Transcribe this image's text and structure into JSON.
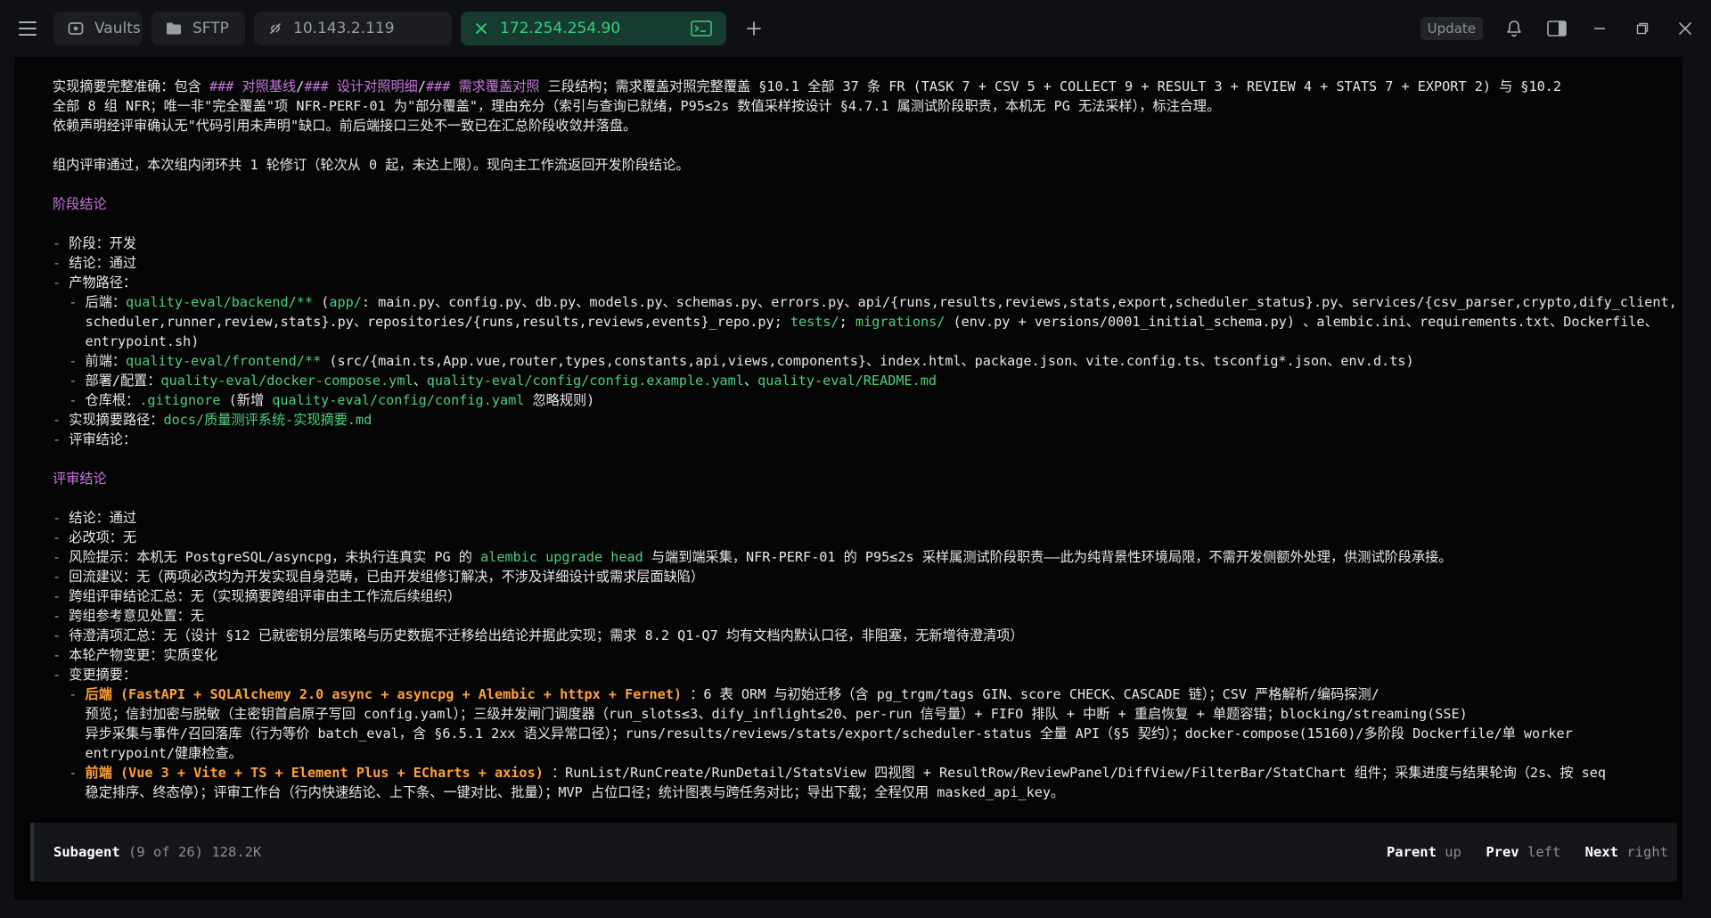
{
  "tabs": {
    "vaults": "Vaults",
    "sftp": "SFTP",
    "host1": "10.143.2.119",
    "host2": "172.254.254.90"
  },
  "topbar": {
    "update": "Update"
  },
  "colors": {
    "accent_green": "#35d07f",
    "path_green": "#4cd07d",
    "heading_purple": "#c678dd",
    "highlight_orange": "#ffa13a"
  },
  "terminal": {
    "lines": [
      [
        [
          "n",
          "实现摘要完整准确：包含 "
        ],
        [
          "p",
          "### 对照基线"
        ],
        [
          "n",
          "/"
        ],
        [
          "p",
          "### 设计对照明细"
        ],
        [
          "n",
          "/"
        ],
        [
          "p",
          "### 需求覆盖对照"
        ],
        [
          "n",
          " 三段结构；需求覆盖对照完整覆盖 §10.1 全部 37 条 FR (TASK 7 + CSV 5 + COLLECT 9 + RESULT 3 + REVIEW 4 + STATS 7 + EXPORT 2) 与 §10.2"
        ]
      ],
      [
        [
          "n",
          "全部 8 组 NFR；唯一非\"完全覆盖\"项 NFR-PERF-01 为\"部分覆盖\"，理由充分（索引与查询已就绪，P95≤2s 数值采样按设计 §4.7.1 属测试阶段职责，本机无 PG 无法采样），标注合理。"
        ]
      ],
      [
        [
          "n",
          "依赖声明经评审确认无\"代码引用未声明\"缺口。前后端接口三处不一致已在汇总阶段收敛并落盘。"
        ]
      ],
      [],
      [
        [
          "n",
          "组内评审通过，本次组内闭环共 1 轮修订（轮次从 0 起，未达上限）。现向主工作流返回开发阶段结论。"
        ]
      ],
      [],
      [
        [
          "p",
          "阶段结论"
        ]
      ],
      [],
      [
        [
          "p",
          "- "
        ],
        [
          "n",
          "阶段：开发"
        ]
      ],
      [
        [
          "p",
          "- "
        ],
        [
          "n",
          "结论：通过"
        ]
      ],
      [
        [
          "p",
          "- "
        ],
        [
          "n",
          "产物路径："
        ]
      ],
      [
        [
          "p",
          "  - "
        ],
        [
          "n",
          "后端："
        ],
        [
          "g",
          "quality-eval/backend/**"
        ],
        [
          "n",
          " ("
        ],
        [
          "g",
          "app/"
        ],
        [
          "n",
          ": main.py、config.py、db.py、models.py、schemas.py、errors.py、api/{runs,results,reviews,stats,export,scheduler_status}.py、services/{csv_parser,crypto,dify_client,"
        ]
      ],
      [
        [
          "n",
          "    scheduler,runner,review,stats}.py、repositories/{runs,results,reviews,events}_repo.py; "
        ],
        [
          "g",
          "tests/"
        ],
        [
          "n",
          "; "
        ],
        [
          "g",
          "migrations/"
        ],
        [
          "n",
          " (env.py + versions/0001_initial_schema.py) 、alembic.ini、requirements.txt、Dockerfile、"
        ]
      ],
      [
        [
          "n",
          "    entrypoint.sh)"
        ]
      ],
      [
        [
          "p",
          "  - "
        ],
        [
          "n",
          "前端："
        ],
        [
          "g",
          "quality-eval/frontend/**"
        ],
        [
          "n",
          " (src/{main.ts,App.vue,router,types,constants,api,views,components}、index.html、package.json、vite.config.ts、tsconfig*.json、env.d.ts)"
        ]
      ],
      [
        [
          "p",
          "  - "
        ],
        [
          "n",
          "部署/配置："
        ],
        [
          "g",
          "quality-eval/docker-compose.yml"
        ],
        [
          "n",
          "、"
        ],
        [
          "g",
          "quality-eval/config/config.example.yaml"
        ],
        [
          "n",
          "、"
        ],
        [
          "g",
          "quality-eval/README.md"
        ]
      ],
      [
        [
          "p",
          "  - "
        ],
        [
          "n",
          "仓库根："
        ],
        [
          "g",
          ".gitignore"
        ],
        [
          "n",
          " (新增 "
        ],
        [
          "g",
          "quality-eval/config/config.yaml"
        ],
        [
          "n",
          " 忽略规则)"
        ]
      ],
      [
        [
          "p",
          "- "
        ],
        [
          "n",
          "实现摘要路径："
        ],
        [
          "g",
          "docs/质量测评系统-实现摘要.md"
        ]
      ],
      [
        [
          "p",
          "- "
        ],
        [
          "n",
          "评审结论："
        ]
      ],
      [],
      [
        [
          "p",
          "评审结论"
        ]
      ],
      [],
      [
        [
          "p",
          "- "
        ],
        [
          "n",
          "结论：通过"
        ]
      ],
      [
        [
          "p",
          "- "
        ],
        [
          "n",
          "必改项：无"
        ]
      ],
      [
        [
          "p",
          "- "
        ],
        [
          "n",
          "风险提示：本机无 PostgreSQL/asyncpg，未执行连真实 PG 的 "
        ],
        [
          "g",
          "alembic upgrade head"
        ],
        [
          "n",
          " 与端到端采集，NFR-PERF-01 的 P95≤2s 采样属测试阶段职责——此为纯背景性环境局限，不需开发侧额外处理，供测试阶段承接。"
        ]
      ],
      [
        [
          "p",
          "- "
        ],
        [
          "n",
          "回流建议：无（两项必改均为开发实现自身范畴，已由开发组修订解决，不涉及详细设计或需求层面缺陷）"
        ]
      ],
      [
        [
          "p",
          "- "
        ],
        [
          "n",
          "跨组评审结论汇总：无（实现摘要跨组评审由主工作流后续组织）"
        ]
      ],
      [
        [
          "p",
          "- "
        ],
        [
          "n",
          "跨组参考意见处置：无"
        ]
      ],
      [
        [
          "p",
          "- "
        ],
        [
          "n",
          "待澄清项汇总：无（设计 §12 已就密钥分层策略与历史数据不迁移给出结论并据此实现；需求 8.2 Q1-Q7 均有文档内默认口径，非阻塞，无新增待澄清项）"
        ]
      ],
      [
        [
          "p",
          "- "
        ],
        [
          "n",
          "本轮产物变更：实质变化"
        ]
      ],
      [
        [
          "p",
          "- "
        ],
        [
          "n",
          "变更摘要："
        ]
      ],
      [
        [
          "p",
          "  - "
        ],
        [
          "o",
          "后端 (FastAPI + SQLAlchemy 2.0 async + asyncpg + Alembic + httpx + Fernet)"
        ],
        [
          "n",
          " ：6 表 ORM 与初始迁移（含 pg_trgm/tags GIN、score CHECK、CASCADE 链）；CSV 严格解析/编码探测/"
        ]
      ],
      [
        [
          "n",
          "    预览；信封加密与脱敏（主密钥首启原子写回 config.yaml）；三级并发闸门调度器（run_slots≤3、dify_inflight≤20、per-run 信号量）+ FIFO 排队 + 中断 + 重启恢复 + 单题容错；blocking/streaming(SSE)"
        ]
      ],
      [
        [
          "n",
          "    异步采集与事件/召回落库（行为等价 batch_eval，含 §6.5.1 2xx 语义异常口径）；runs/results/reviews/stats/export/scheduler-status 全量 API（§5 契约）；docker-compose(15160)/多阶段 Dockerfile/单 worker"
        ]
      ],
      [
        [
          "n",
          "    entrypoint/健康检查。"
        ]
      ],
      [
        [
          "p",
          "  - "
        ],
        [
          "o",
          "前端 (Vue 3 + Vite + TS + Element Plus + ECharts + axios)"
        ],
        [
          "n",
          " ：RunList/RunCreate/RunDetail/StatsView 四视图 + ResultRow/ReviewPanel/DiffView/FilterBar/StatChart 组件；采集进度与结果轮询（2s、按 seq"
        ]
      ],
      [
        [
          "n",
          "    稳定排序、终态停）；评审工作台（行内快速结论、上下条、一键对比、批量）；MVP 占位口径；统计图表与跨任务对比；导出下载；全程仅用 masked_api_key。"
        ]
      ]
    ]
  },
  "footer": {
    "label": "Subagent",
    "count": "(9 of 26)",
    "size": "128.2K",
    "parent": "Parent",
    "parent_key": "up",
    "prev": "Prev",
    "prev_key": "left",
    "next": "Next",
    "next_key": "right"
  }
}
